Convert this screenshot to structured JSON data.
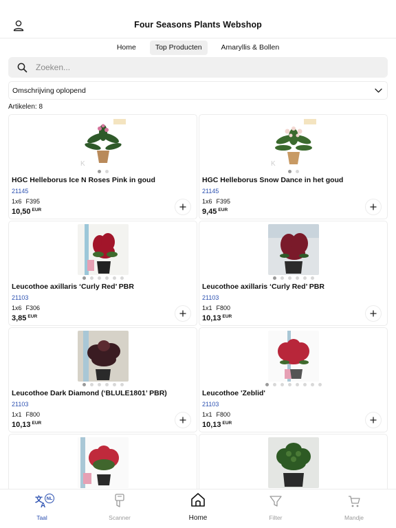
{
  "header": {
    "title": "Four Seasons Plants Webshop"
  },
  "tabs": [
    {
      "label": "Home",
      "active": false
    },
    {
      "label": "Top Producten",
      "active": true
    },
    {
      "label": "Amaryllis & Bollen",
      "active": false
    }
  ],
  "search": {
    "placeholder": "Zoeken..."
  },
  "sort": {
    "selected": "Omschrijving oplopend"
  },
  "count_text": "Artikelen: 8",
  "products": [
    {
      "name": "HGC Helleborus Ice N Roses Pink in goud",
      "code": "21145",
      "qty": "1x6",
      "size": "F395",
      "price": "10,50",
      "currency": "EUR",
      "image_dots": 2,
      "active_dot": 0
    },
    {
      "name": "HGC Helleborus Snow Dance in het goud",
      "code": "21145",
      "qty": "1x6",
      "size": "F395",
      "price": "9,45",
      "currency": "EUR",
      "image_dots": 2,
      "active_dot": 0
    },
    {
      "name": "Leucothoe axillaris ‘Curly Red’ PBR",
      "code": "21103",
      "qty": "1x6",
      "size": "F306",
      "price": "3,85",
      "currency": "EUR",
      "image_dots": 6,
      "active_dot": 0
    },
    {
      "name": "Leucothoe axillaris ‘Curly Red’ PBR",
      "code": "21103",
      "qty": "1x1",
      "size": "F800",
      "price": "10,13",
      "currency": "EUR",
      "image_dots": 6,
      "active_dot": 0
    },
    {
      "name": "Leucothoe Dark Diamond (‘BLULE1801’ PBR)",
      "code": "21103",
      "qty": "1x1",
      "size": "F800",
      "price": "10,13",
      "currency": "EUR",
      "image_dots": 6,
      "active_dot": 0
    },
    {
      "name": "Leucothoe 'Zeblid'",
      "code": "21103",
      "qty": "1x1",
      "size": "F800",
      "price": "10,13",
      "currency": "EUR",
      "image_dots": 8,
      "active_dot": 0
    },
    {
      "name": "",
      "code": "",
      "qty": "",
      "size": "",
      "price": "",
      "currency": "",
      "image_dots": 0,
      "active_dot": 0
    },
    {
      "name": "",
      "code": "",
      "qty": "",
      "size": "",
      "price": "",
      "currency": "",
      "image_dots": 0,
      "active_dot": 0
    }
  ],
  "bottom_nav": [
    {
      "label": "Taal",
      "icon": "language-icon",
      "badge": "NL",
      "state": "active"
    },
    {
      "label": "Scanner",
      "icon": "scanner-icon",
      "state": "inactive"
    },
    {
      "label": "Home",
      "icon": "home-icon",
      "state": "current"
    },
    {
      "label": "Filter",
      "icon": "filter-icon",
      "state": "inactive"
    },
    {
      "label": "Mandje",
      "icon": "cart-icon",
      "state": "inactive"
    }
  ],
  "colors": {
    "accent": "#2a4fb0",
    "border": "#ececec",
    "search_bg": "#f0f0f0"
  }
}
